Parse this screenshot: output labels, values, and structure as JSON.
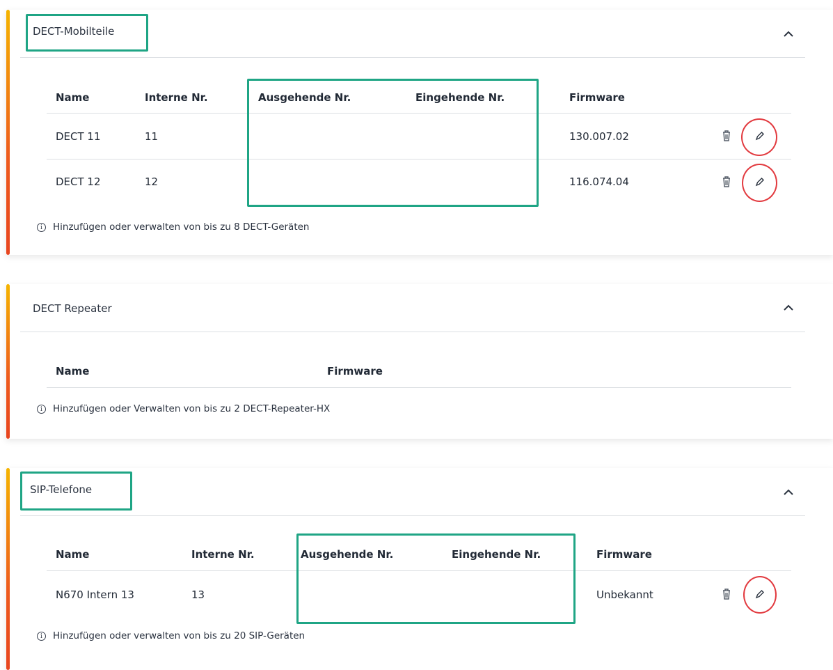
{
  "colors": {
    "accent_top": "#f5b400",
    "accent_bottom": "#e8451f",
    "highlight_green": "#1fa585",
    "highlight_red": "#e23a3f"
  },
  "dect": {
    "title": "DECT-Mobilteile",
    "headers": {
      "name": "Name",
      "internal": "Interne Nr.",
      "outgoing": "Ausgehende Nr.",
      "incoming": "Eingehende Nr.",
      "firmware": "Firmware"
    },
    "rows": [
      {
        "name": "DECT 11",
        "internal": "11",
        "outgoing": "",
        "incoming": "",
        "firmware": "130.007.02"
      },
      {
        "name": "DECT 12",
        "internal": "12",
        "outgoing": "",
        "incoming": "",
        "firmware": "116.074.04"
      }
    ],
    "hint": "Hinzufügen oder verwalten von bis zu 8 DECT-Geräten"
  },
  "repeater": {
    "title": "DECT Repeater",
    "headers": {
      "name": "Name",
      "firmware": "Firmware"
    },
    "hint": "Hinzufügen oder Verwalten von bis zu 2 DECT-Repeater-HX"
  },
  "sip": {
    "title": "SIP-Telefone",
    "headers": {
      "name": "Name",
      "internal": "Interne Nr.",
      "outgoing": "Ausgehende Nr.",
      "incoming": "Eingehende Nr.",
      "firmware": "Firmware"
    },
    "rows": [
      {
        "name": "N670 Intern 13",
        "internal": "13",
        "outgoing": "",
        "incoming": "",
        "firmware": "Unbekannt"
      }
    ],
    "hint": "Hinzufügen oder verwalten von bis zu 20 SIP-Geräten"
  },
  "icons": {
    "collapse": "chevron-up-icon",
    "delete": "trash-icon",
    "edit": "pencil-icon",
    "info": "info-icon"
  }
}
